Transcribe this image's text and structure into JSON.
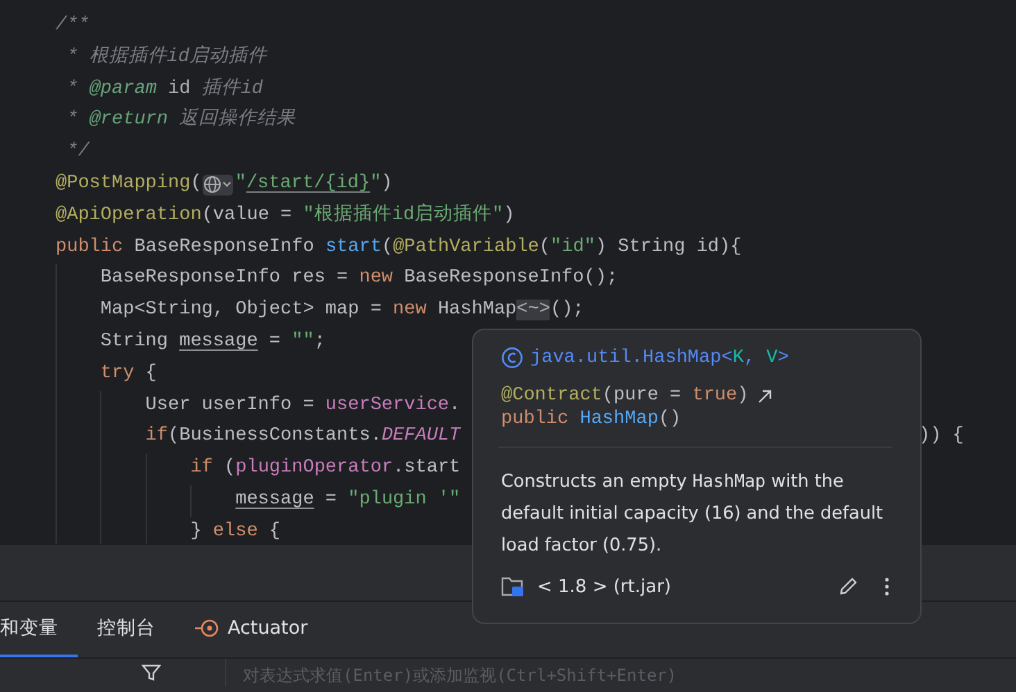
{
  "editor": {
    "lines": [
      {
        "tokens": [
          {
            "text": "/**",
            "kind": "comment"
          }
        ]
      },
      {
        "tokens": [
          {
            "text": " * 根据插件id启动插件",
            "kind": "comment"
          }
        ]
      },
      {
        "tokens": [
          {
            "text": " * ",
            "kind": "comment"
          },
          {
            "text": "@param",
            "kind": "doc-tag"
          },
          {
            "text": " id",
            "kind": "doc-param"
          },
          {
            "text": " 插件id",
            "kind": "comment"
          }
        ]
      },
      {
        "tokens": [
          {
            "text": " * ",
            "kind": "comment"
          },
          {
            "text": "@return",
            "kind": "doc-tag"
          },
          {
            "text": " 返回操作结果",
            "kind": "comment"
          }
        ]
      },
      {
        "tokens": [
          {
            "text": " */",
            "kind": "comment"
          }
        ]
      },
      {
        "tokens": [
          {
            "text": "@PostMapping",
            "kind": "annotation"
          },
          {
            "text": "(",
            "kind": "plain"
          },
          {
            "kind": "url-inlay"
          },
          {
            "text": "\"",
            "kind": "string"
          },
          {
            "text": "/start/{id}",
            "kind": "url"
          },
          {
            "text": "\"",
            "kind": "string"
          },
          {
            "text": ")",
            "kind": "plain"
          }
        ]
      },
      {
        "tokens": [
          {
            "text": "@ApiOperation",
            "kind": "annotation"
          },
          {
            "text": "(value = ",
            "kind": "plain"
          },
          {
            "text": "\"根据插件id启动插件\"",
            "kind": "string"
          },
          {
            "text": ")",
            "kind": "plain"
          }
        ]
      },
      {
        "tokens": [
          {
            "text": "public ",
            "kind": "keyword"
          },
          {
            "text": "BaseResponseInfo ",
            "kind": "plain"
          },
          {
            "text": "start",
            "kind": "method"
          },
          {
            "text": "(",
            "kind": "plain"
          },
          {
            "text": "@PathVariable",
            "kind": "annotation"
          },
          {
            "text": "(",
            "kind": "plain"
          },
          {
            "text": "\"id\"",
            "kind": "string"
          },
          {
            "text": ") String id){",
            "kind": "plain"
          }
        ],
        "children": [
          {
            "tokens": [
              {
                "text": "BaseResponseInfo res = ",
                "kind": "plain"
              },
              {
                "text": "new ",
                "kind": "keyword"
              },
              {
                "text": "BaseResponseInfo();",
                "kind": "plain"
              }
            ]
          },
          {
            "tokens": [
              {
                "text": "Map<String, Object> map = ",
                "kind": "plain"
              },
              {
                "text": "new ",
                "kind": "keyword"
              },
              {
                "text": "HashMap",
                "kind": "plain"
              },
              {
                "text": "<~>",
                "kind": "folded"
              },
              {
                "text": "();",
                "kind": "plain"
              }
            ]
          },
          {
            "tokens": [
              {
                "text": "String ",
                "kind": "plain"
              },
              {
                "text": "message",
                "kind": "reassigned"
              },
              {
                "text": " = ",
                "kind": "plain"
              },
              {
                "text": "\"\"",
                "kind": "string"
              },
              {
                "text": ";",
                "kind": "plain"
              }
            ]
          },
          {
            "tokens": [
              {
                "text": "try ",
                "kind": "keyword"
              },
              {
                "text": "{",
                "kind": "plain"
              }
            ],
            "children": [
              {
                "tokens": [
                  {
                    "text": "User userInfo = ",
                    "kind": "plain"
                  },
                  {
                    "text": "userService",
                    "kind": "field"
                  },
                  {
                    "text": ".",
                    "kind": "plain"
                  }
                ]
              },
              {
                "tokens": [
                  {
                    "text": "if",
                    "kind": "keyword"
                  },
                  {
                    "text": "(BusinessConstants.",
                    "kind": "plain"
                  },
                  {
                    "text": "DEFAULT",
                    "kind": "constant"
                  },
                  {
                    "text": ")) {",
                    "kind": "tail"
                  }
                ],
                "children": [
                  {
                    "tokens": [
                      {
                        "text": "if ",
                        "kind": "keyword"
                      },
                      {
                        "text": "(",
                        "kind": "plain"
                      },
                      {
                        "text": "pluginOperator",
                        "kind": "field"
                      },
                      {
                        "text": ".start",
                        "kind": "plain"
                      }
                    ],
                    "children": [
                      {
                        "tokens": [
                          {
                            "text": "message",
                            "kind": "reassigned"
                          },
                          {
                            "text": " = ",
                            "kind": "plain"
                          },
                          {
                            "text": "\"plugin '\"",
                            "kind": "string"
                          }
                        ]
                      }
                    ]
                  },
                  {
                    "tokens": [
                      {
                        "text": "} ",
                        "kind": "plain"
                      },
                      {
                        "text": "else ",
                        "kind": "keyword"
                      },
                      {
                        "text": "{",
                        "kind": "plain"
                      }
                    ]
                  }
                ]
              }
            ]
          }
        ]
      }
    ]
  },
  "tool_window": {
    "tabs": [
      {
        "label": "和变量",
        "selected": true,
        "kind": "plain"
      },
      {
        "label": "控制台",
        "selected": false,
        "kind": "plain"
      },
      {
        "label": "Actuator",
        "selected": false,
        "kind": "with-icon"
      }
    ],
    "evaluate_field": {
      "placeholder": "对表达式求值(Enter)或添加监视(Ctrl+Shift+Enter)"
    }
  },
  "doc_popup": {
    "class_name": [
      {
        "text": "java.util.HashMap<",
        "kind": "class"
      },
      {
        "text": "K",
        "kind": "type-param"
      },
      {
        "text": ", ",
        "kind": "class"
      },
      {
        "text": "V",
        "kind": "type-param"
      },
      {
        "text": ">",
        "kind": "class"
      }
    ],
    "annotation": [
      {
        "text": "@Contract",
        "kind": "annotation"
      },
      {
        "text": "(pure = ",
        "kind": "plain"
      },
      {
        "text": "true",
        "kind": "keyword"
      },
      {
        "text": ")",
        "kind": "plain"
      }
    ],
    "signature": [
      {
        "text": "public ",
        "kind": "keyword"
      },
      {
        "text": "HashMap",
        "kind": "method"
      },
      {
        "text": "()",
        "kind": "plain"
      }
    ],
    "description": [
      {
        "text": "Constructs an empty ",
        "kind": "text"
      },
      {
        "text": "HashMap",
        "kind": "code"
      },
      {
        "text": " with the default initial capacity (16) and the default load factor (0.75).",
        "kind": "text"
      }
    ],
    "library": "< 1.8 > (rt.jar)"
  }
}
